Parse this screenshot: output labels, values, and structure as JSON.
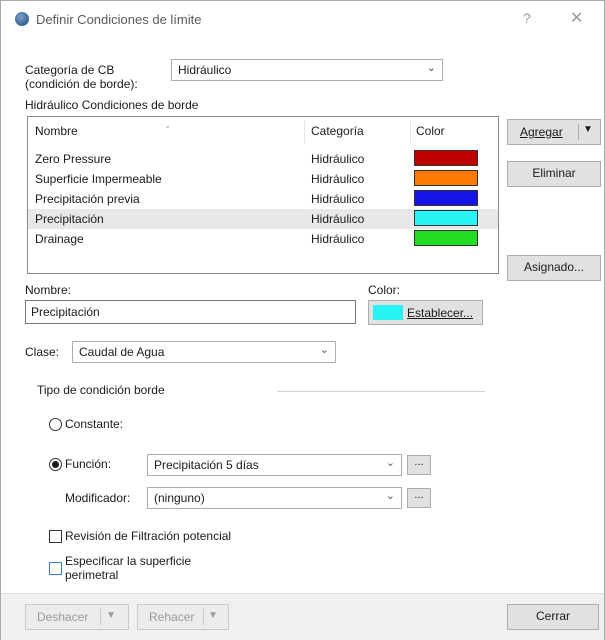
{
  "window": {
    "title": "Definir Condiciones de límite",
    "help": "?",
    "close": "✕"
  },
  "categoria": {
    "label_line1": "Categoría de CB",
    "label_line2": "(condición de borde):",
    "value": "Hidráulico"
  },
  "list": {
    "caption": "Hidráulico Condiciones de borde",
    "headers": {
      "name": "Nombre",
      "category": "Categoría",
      "color": "Color"
    },
    "rows": [
      {
        "name": "Zero Pressure",
        "category": "Hidráulico",
        "color": "#c00000"
      },
      {
        "name": "Superficie Impermeable",
        "category": "Hidráulico",
        "color": "#ff7b00"
      },
      {
        "name": "Precipitación previa",
        "category": "Hidráulico",
        "color": "#1414e6"
      },
      {
        "name": "Precipitación",
        "category": "Hidráulico",
        "color": "#29f4f4"
      },
      {
        "name": "Drainage",
        "category": "Hidráulico",
        "color": "#22dd22"
      }
    ],
    "selected_index": 3
  },
  "buttons": {
    "agregar": "Agregar",
    "eliminar": "Eliminar",
    "asignado": "Asignado...",
    "establecer": "Establecer...",
    "deshacer": "Deshacer",
    "rehacer": "Rehacer",
    "cerrar": "Cerrar"
  },
  "nombre": {
    "label": "Nombre:",
    "value": "Precipitación"
  },
  "color": {
    "label": "Color:",
    "value": "#29f4f4"
  },
  "clase": {
    "label": "Clase:",
    "value": "Caudal de Agua"
  },
  "tipo": {
    "section_label": "Tipo de condición borde",
    "constante_label": "Constante:",
    "funcion_label": "Función:",
    "funcion_value": "Precipitación 5 días",
    "modificador_label": "Modificador:",
    "modificador_value": "(ninguno)",
    "ellipsis": "...",
    "selected": "funcion"
  },
  "checks": {
    "revision": "Revisión de Filtración potencial",
    "especificar_line1": "Especificar la superficie",
    "especificar_line2": "perimetral"
  }
}
